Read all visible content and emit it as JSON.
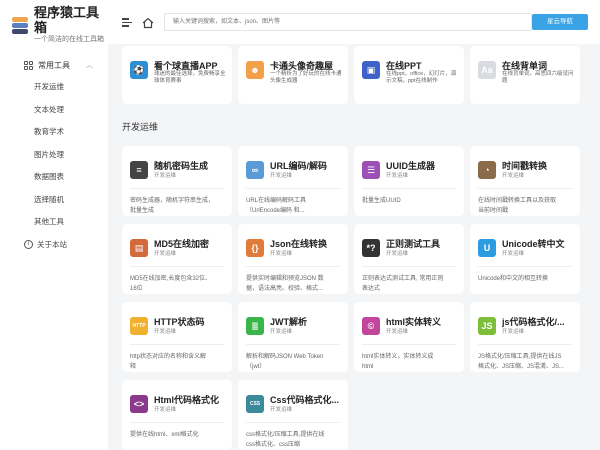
{
  "brand": {
    "title": "程序猿工具箱",
    "subtitle": "一个简洁的在线工具箱"
  },
  "menu": {
    "group": "常用工具",
    "items": [
      "开发运维",
      "文本处理",
      "教育学术",
      "图片处理",
      "数据图表",
      "选择随机",
      "其他工具"
    ],
    "about": "关于本站"
  },
  "topbar": {
    "search_placeholder": "输入关键词搜索，如文本、json、图片等",
    "nav_label": "星云导航"
  },
  "featured": [
    {
      "title": "看个球直播APP",
      "desc": "球迷的最佳选择，免费畅享全球体育赛事",
      "color": "#2d8fd6",
      "glyph": "⚽"
    },
    {
      "title": "卡通头像奇趣屋",
      "desc": "一个精析为了好玩的在线卡通头像生成器",
      "color": "#f3a04b",
      "glyph": "☻"
    },
    {
      "title": "在线PPT",
      "desc": "在线ppt，office，幻灯片，演示文稿，ppt在线制作",
      "color": "#3f62c9",
      "glyph": "▣"
    },
    {
      "title": "在线背单词",
      "desc": "在线背单词，高思四六级没问题",
      "color": "#d9dbe0",
      "glyph": "Aa"
    }
  ],
  "section": {
    "title": "开发运维"
  },
  "tools": [
    {
      "title": "随机密码生成",
      "cat": "开发运维",
      "desc": [
        "密码生成器，随机字符串生成，",
        "批量生成"
      ],
      "color": "#444",
      "glyph": "≡"
    },
    {
      "title": "URL编码/解码",
      "cat": "开发运维",
      "desc": [
        "URL在线编码解码工具",
        "（UrlEncode编码 和..."
      ],
      "color": "#5b9bd5",
      "glyph": "∞"
    },
    {
      "title": "UUID生成器",
      "cat": "开发运维",
      "desc": [
        "批量生成UUID"
      ],
      "color": "#9c4fb5",
      "glyph": "☰"
    },
    {
      "title": "时间戳转换",
      "cat": "开发运维",
      "desc": [
        "在线时间戳转换工具以及获取",
        "当前时间戳"
      ],
      "color": "#8a6b4a",
      "glyph": "◔"
    },
    {
      "title": "MD5在线加密",
      "cat": "开发运维",
      "desc": [
        "MD5在线加密,长度包含32位、",
        "16位"
      ],
      "color": "#d26a3c",
      "glyph": "▤"
    },
    {
      "title": "Json在线转换",
      "cat": "开发运维",
      "desc": [
        "提供实时编辑和预览JSON 数",
        "据，语法高亮、校验、格式..."
      ],
      "color": "#e07b39",
      "glyph": "{}"
    },
    {
      "title": "正则测试工具",
      "cat": "开发运维",
      "desc": [
        "正则表达式测试工具, 常用正则",
        "表达式"
      ],
      "color": "#333",
      "glyph": "*?"
    },
    {
      "title": "Unicode转中文",
      "cat": "开发运维",
      "desc": [
        "Unicode和中文的相互转换"
      ],
      "color": "#2d9be0",
      "glyph": "U"
    },
    {
      "title": "HTTP状态码",
      "cat": "开发运维",
      "desc": [
        "http状态对应的名称和含义解",
        "释"
      ],
      "color": "#f0b030",
      "glyph": "HTTP"
    },
    {
      "title": "JWT解析",
      "cat": "开发运维",
      "desc": [
        "解析和解码JSON Web Token",
        "（jwt）"
      ],
      "color": "#39b54a",
      "glyph": "≣"
    },
    {
      "title": "html实体转义",
      "cat": "开发运维",
      "desc": [
        "html实体转义，实体转义成",
        "html"
      ],
      "color": "#c2479b",
      "glyph": "©"
    },
    {
      "title": "js代码格式化/...",
      "cat": "开发运维",
      "desc": [
        "JS格式化/压缩工具,提供在线JS",
        "格式化、JS压缩、JS混淆、JS..."
      ],
      "color": "#7cbf3a",
      "glyph": "JS"
    },
    {
      "title": "Html代码格式化",
      "cat": "开发运维",
      "desc": [
        "提供在线html、xml格式化"
      ],
      "color": "#8a3a8c",
      "glyph": "<>"
    },
    {
      "title": "Css代码格式化...",
      "cat": "开发运维",
      "desc": [
        "css格式化/压缩工具,提供在线",
        "css格式化、css压缩"
      ],
      "color": "#3a8a9a",
      "glyph": "CSS"
    }
  ]
}
